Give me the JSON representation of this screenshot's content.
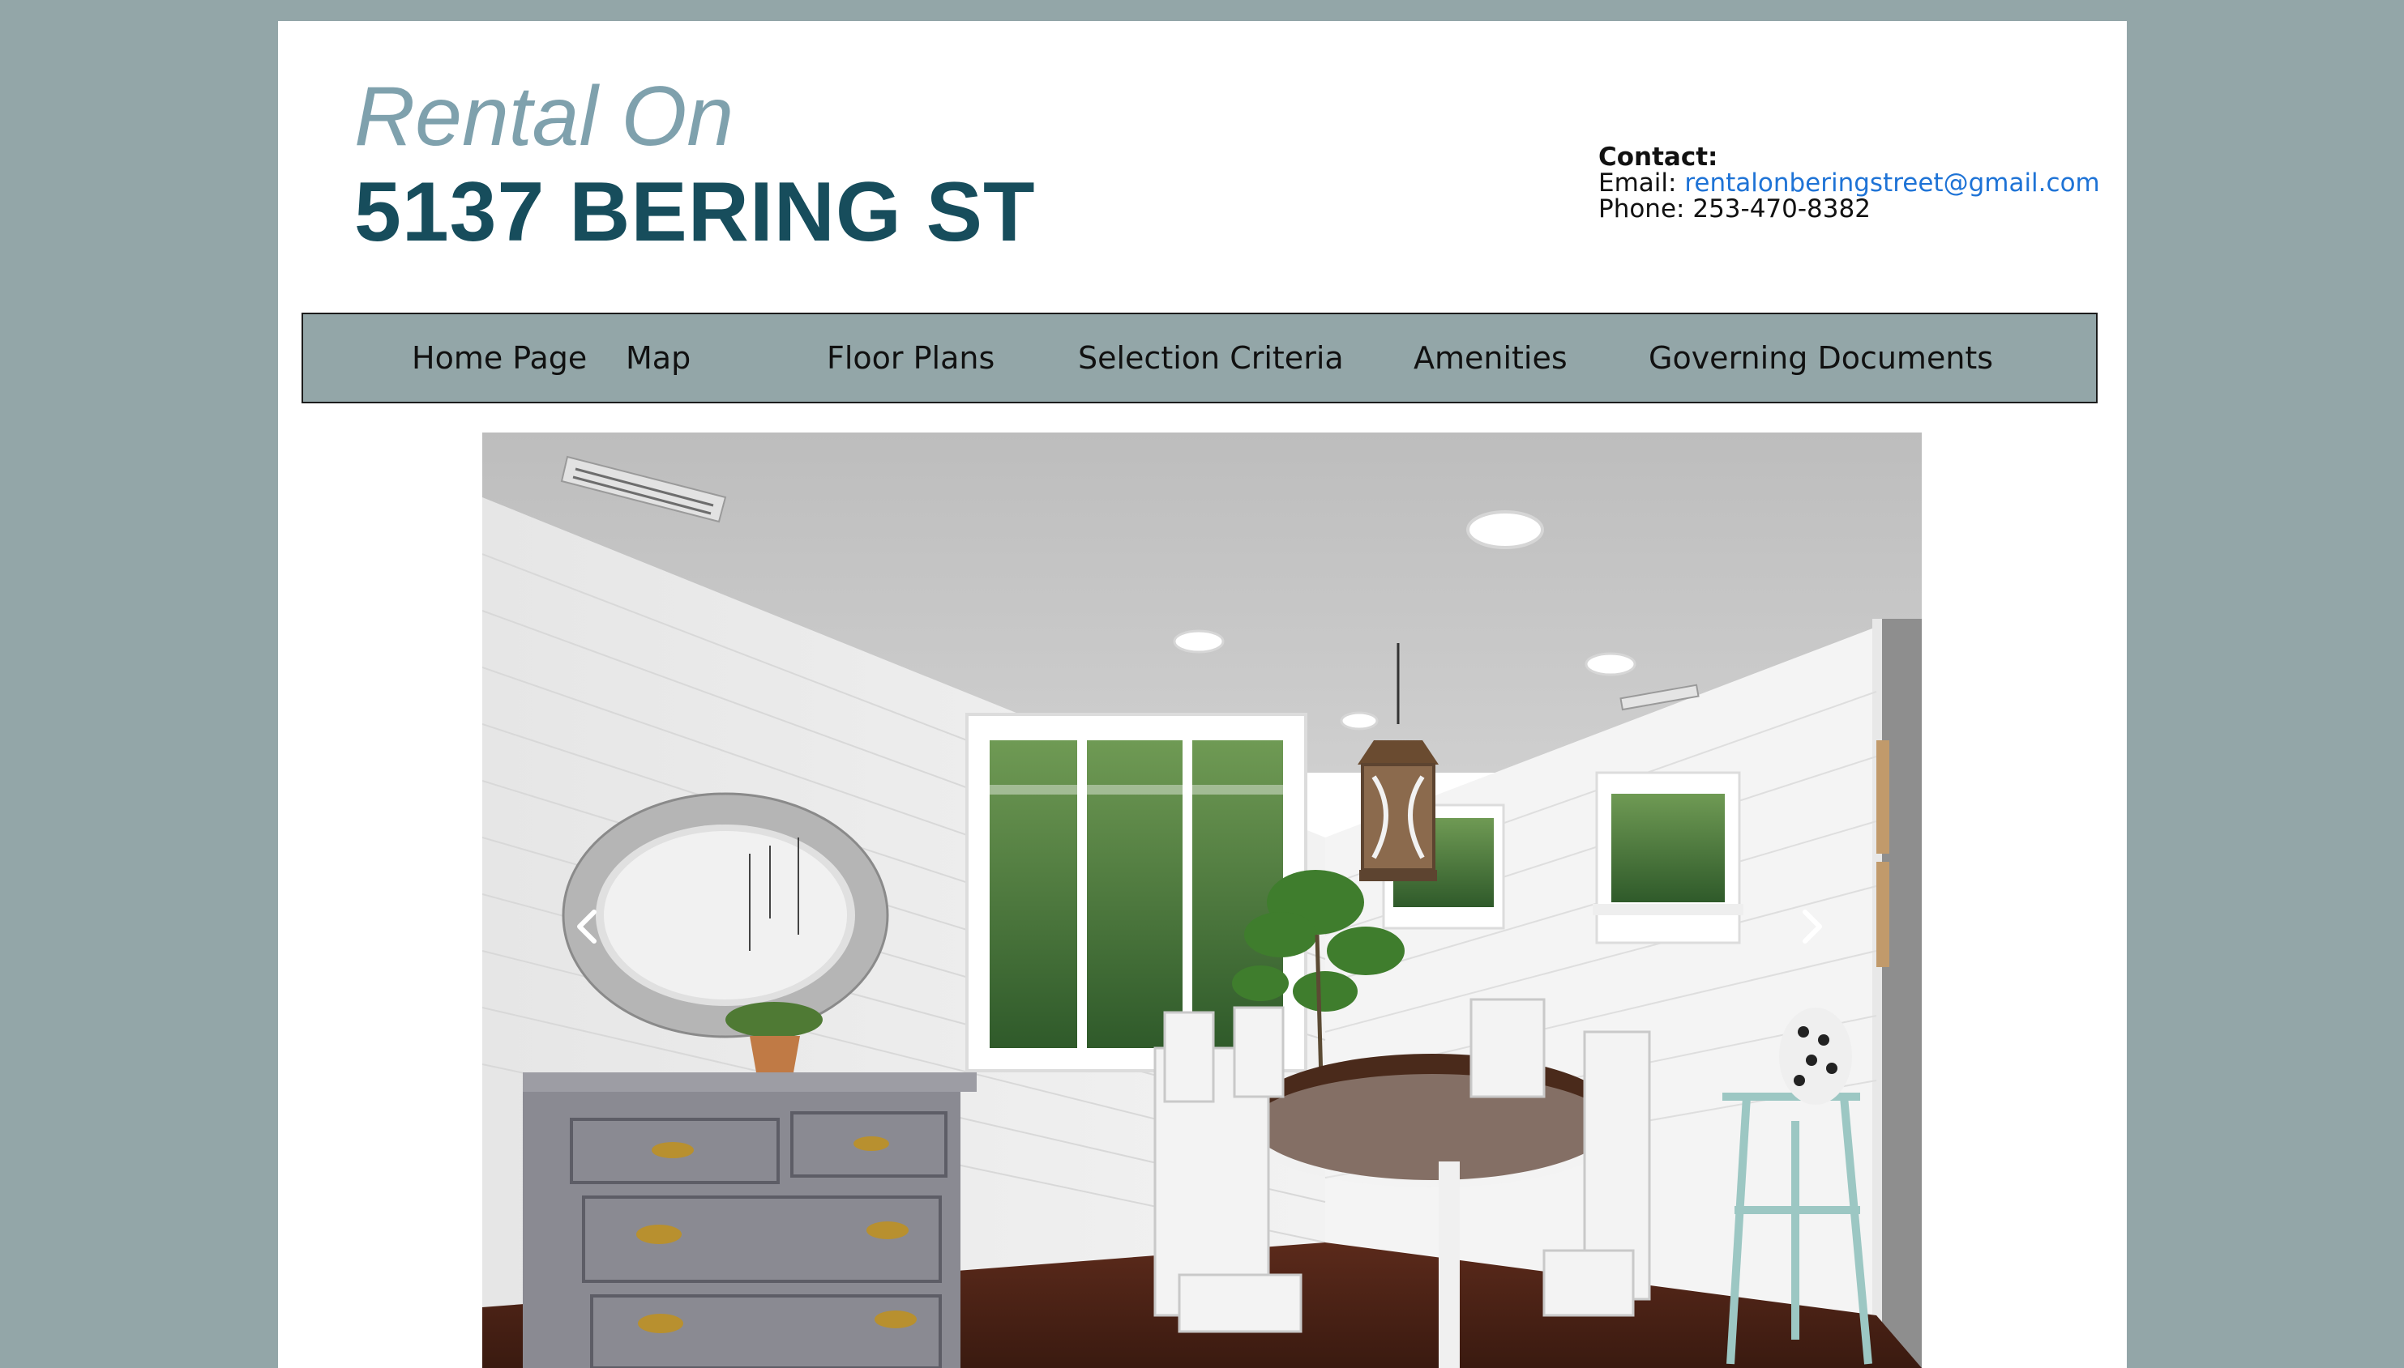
{
  "header": {
    "title_line1": "Rental On",
    "title_line2": "5137 BERING ST"
  },
  "contact": {
    "heading": "Contact:",
    "email_label": "Email:",
    "email": "rentalonberingstreet@gmail.com",
    "phone_label": "Phone:",
    "phone": "253-470-8382"
  },
  "nav": {
    "items": [
      {
        "label": "Home Page"
      },
      {
        "label": "Map"
      },
      {
        "label": "Floor Plans"
      },
      {
        "label": "Selection Criteria"
      },
      {
        "label": "Amenities"
      },
      {
        "label": "Governing Documents"
      }
    ]
  },
  "carousel": {
    "prev_icon": "chevron-left-icon",
    "next_icon": "chevron-right-icon"
  },
  "colors": {
    "page_background": "#93a6a8",
    "title_light": "#7fa1ad",
    "title_dark": "#174d5c",
    "link": "#1e73d6",
    "nav_background": "#93a6a8"
  }
}
